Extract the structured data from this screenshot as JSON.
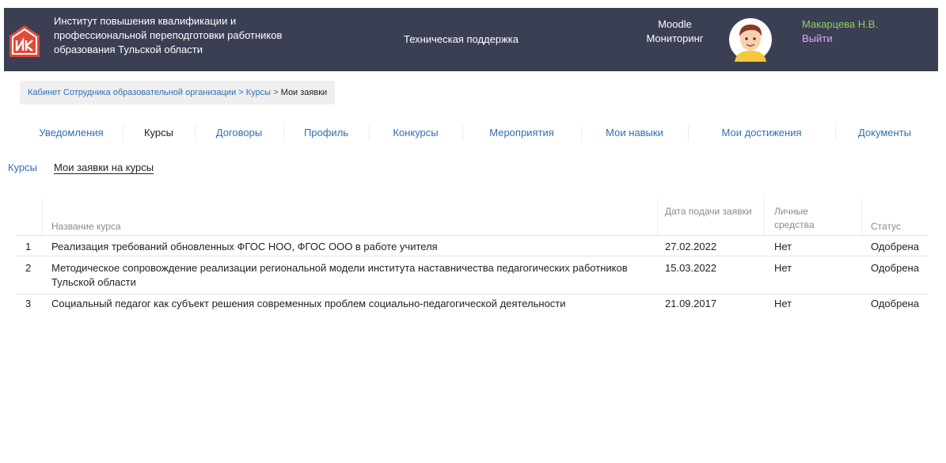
{
  "header": {
    "org_name": "Институт повышения квалификации и профессиональной переподготовки работников образования Тульской области",
    "support_label": "Техническая поддержка",
    "moodle_label": "Moodle",
    "monitoring_label": "Мониторинг",
    "user_name": "Макарцева Н.В.",
    "logout_label": "Выйти",
    "colors": {
      "bg": "#3b3f54",
      "user": "#8fd15a",
      "logout": "#e8a0ff"
    }
  },
  "breadcrumb": {
    "items": [
      "Кабинет Сотрудника образовательной организации",
      "Курсы",
      "Мои заявки"
    ],
    "separator": ">"
  },
  "tabs": [
    {
      "label": "Уведомления"
    },
    {
      "label": "Курсы",
      "active": true
    },
    {
      "label": "Договоры"
    },
    {
      "label": "Профиль"
    },
    {
      "label": "Конкурсы"
    },
    {
      "label": "Мероприятия"
    },
    {
      "label": "Мои навыки"
    },
    {
      "label": "Мои достижения"
    },
    {
      "label": "Документы"
    }
  ],
  "subnav": {
    "courses_label": "Курсы",
    "applications_label": "Мои заявки на курсы"
  },
  "table": {
    "headers": {
      "course_name": "Название курса",
      "date": "Дата подачи заявки",
      "personal_funds": "Личные средства",
      "status": "Статус"
    },
    "rows": [
      {
        "num": "1",
        "course": "Реализация требований обновленных ФГОС НОО, ФГОС ООО в работе учителя",
        "date": "27.02.2022",
        "funds": "Нет",
        "status": "Одобрена"
      },
      {
        "num": "2",
        "course": "Методическое сопровождение реализации региональной модели института наставничества педагогических работников Тульской области",
        "date": "15.03.2022",
        "funds": "Нет",
        "status": "Одобрена"
      },
      {
        "num": "3",
        "course": "Социальный педагог как субъект решения современных проблем социально-педагогической деятельности",
        "date": "21.09.2017",
        "funds": "Нет",
        "status": "Одобрена"
      }
    ]
  }
}
